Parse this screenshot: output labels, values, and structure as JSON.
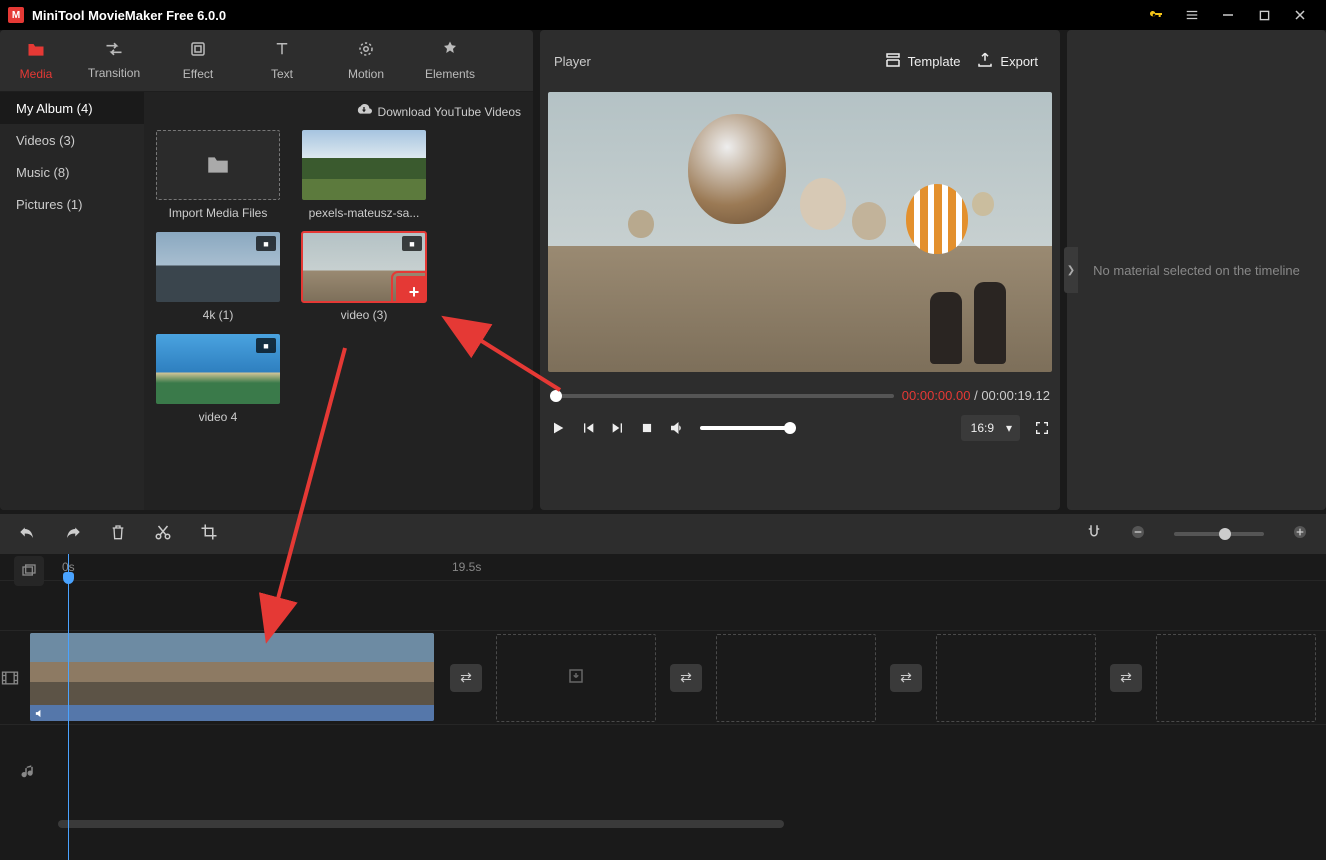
{
  "app": {
    "title": "MiniTool MovieMaker Free 6.0.0"
  },
  "tabs": {
    "media": "Media",
    "transition": "Transition",
    "effect": "Effect",
    "text": "Text",
    "motion": "Motion",
    "elements": "Elements"
  },
  "sidebar": {
    "items": [
      {
        "label": "My Album (4)"
      },
      {
        "label": "Videos (3)"
      },
      {
        "label": "Music (8)"
      },
      {
        "label": "Pictures (1)"
      }
    ]
  },
  "gallery": {
    "download_link": "Download YouTube Videos",
    "import_label": "Import Media Files",
    "items": [
      {
        "label": "pexels-mateusz-sa..."
      },
      {
        "label": "4k (1)"
      },
      {
        "label": "video (3)"
      },
      {
        "label": "video 4"
      }
    ]
  },
  "player": {
    "title": "Player",
    "template_btn": "Template",
    "export_btn": "Export",
    "time_current": "00:00:00.00",
    "time_sep": " / ",
    "time_total": "00:00:19.12",
    "aspect": "16:9"
  },
  "prop": {
    "empty_msg": "No material selected on the timeline"
  },
  "timeline": {
    "ruler": {
      "t0": "0s",
      "t1": "19.5s"
    }
  }
}
